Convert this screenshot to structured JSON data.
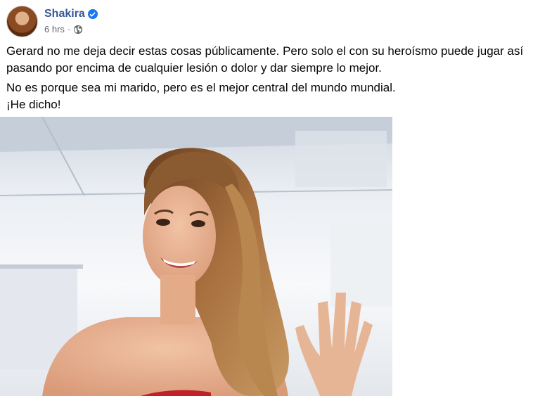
{
  "post": {
    "author": "Shakira",
    "verified": true,
    "timestamp": "6 hrs",
    "separator": "·",
    "audience_icon": "globe-icon",
    "paragraphs": [
      "Gerard no me deja decir estas cosas públicamente. Pero solo el con su heroísmo puede jugar así pasando por encima de cualquier lesión o dolor y dar siempre lo mejor.",
      "No es porque sea mi marido, pero es el mejor central del mundo mundial.",
      "¡He dicho!"
    ]
  },
  "colors": {
    "author": "#385898",
    "verified_badge": "#1877f2",
    "meta_text": "#65676b",
    "body_text": "#050505"
  }
}
